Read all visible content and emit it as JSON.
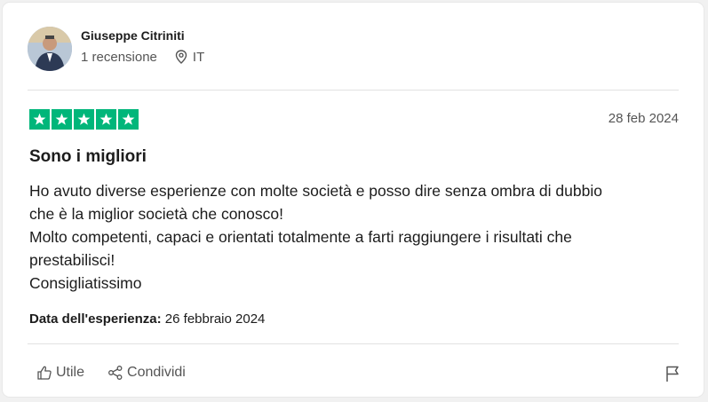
{
  "reviewer": {
    "name": "Giuseppe Citriniti",
    "reviews_count": "1 recensione",
    "country": "IT"
  },
  "review": {
    "rating": 5,
    "date": "28 feb 2024",
    "title": "Sono i migliori",
    "body_lines": [
      "Ho avuto diverse esperienze con molte società e posso dire senza ombra di dubbio",
      "che è la miglior società che conosco!",
      "Molto competenti, capaci e orientati totalmente a farti raggiungere i risultati che",
      "prestabilisci!",
      "Consigliatissimo"
    ],
    "experience_label": "Data dell'esperienza:",
    "experience_date": "26 febbraio 2024"
  },
  "actions": {
    "useful_label": "Utile",
    "share_label": "Condividi"
  },
  "colors": {
    "star_green": "#00b67a",
    "text": "#1c1c1c",
    "muted": "#555555"
  },
  "icons": [
    "location-pin-icon",
    "star-icon",
    "thumbs-up-icon",
    "share-icon",
    "flag-icon"
  ]
}
